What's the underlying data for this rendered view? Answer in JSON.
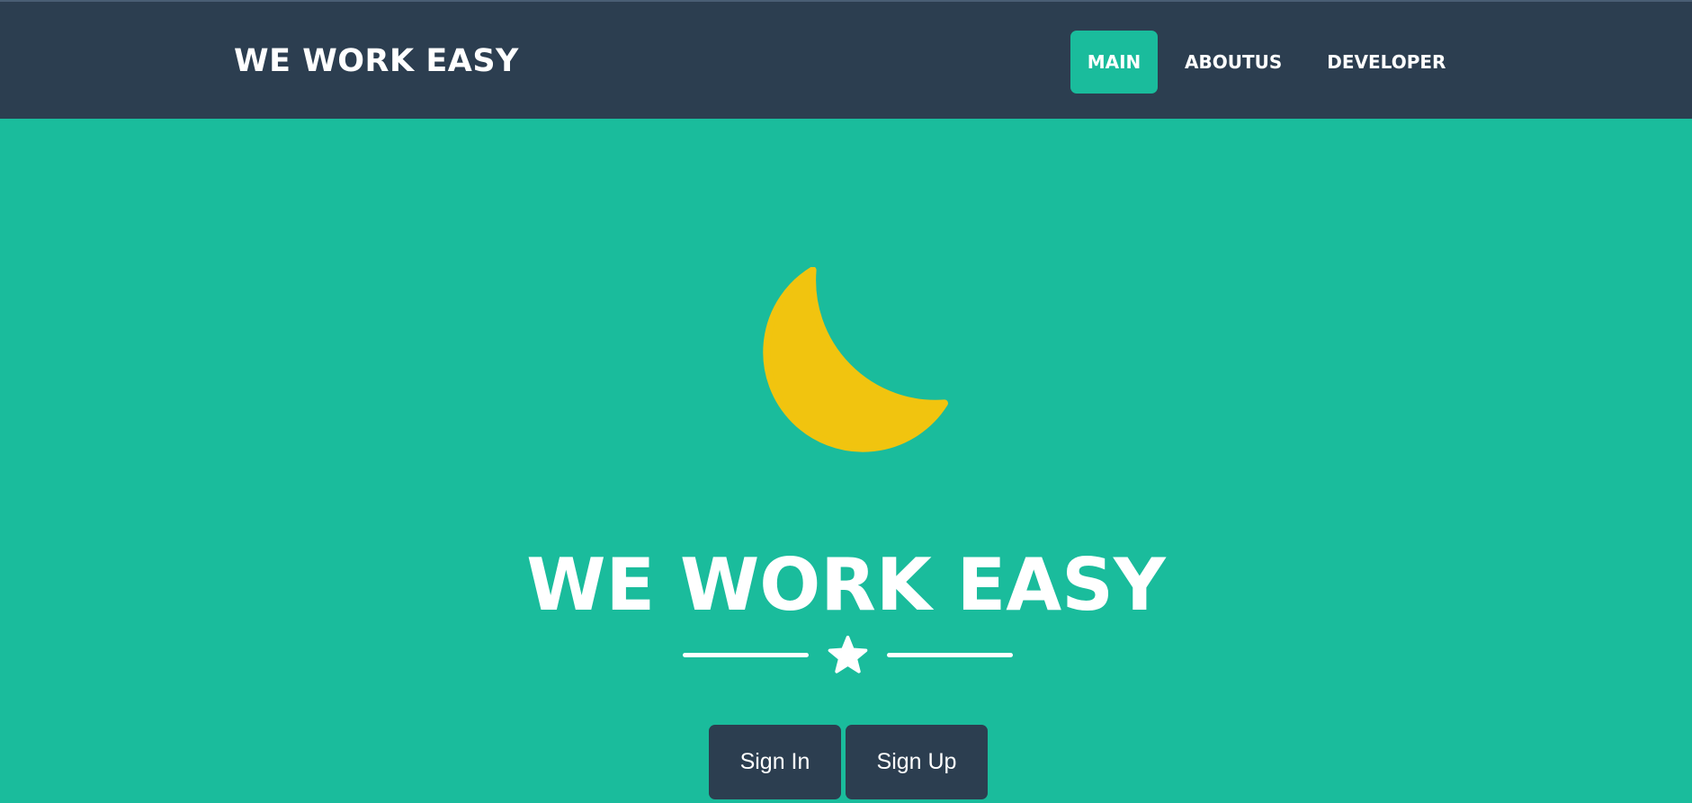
{
  "navbar": {
    "brand": "WE WORK EASY",
    "items": [
      {
        "label": "MAIN",
        "active": true
      },
      {
        "label": "ABOUTUS",
        "active": false
      },
      {
        "label": "DEVELOPER",
        "active": false
      }
    ]
  },
  "hero": {
    "icon": "crescent-moon-icon",
    "title": "WE WORK EASY",
    "divider_icon": "star-icon",
    "buttons": {
      "sign_in": "Sign In",
      "sign_up": "Sign Up"
    }
  },
  "colors": {
    "navbar_bg": "#2c3e50",
    "primary": "#1abc9c",
    "moon": "#f1c40f",
    "text": "#ffffff",
    "button_bg": "#2c3e50"
  }
}
